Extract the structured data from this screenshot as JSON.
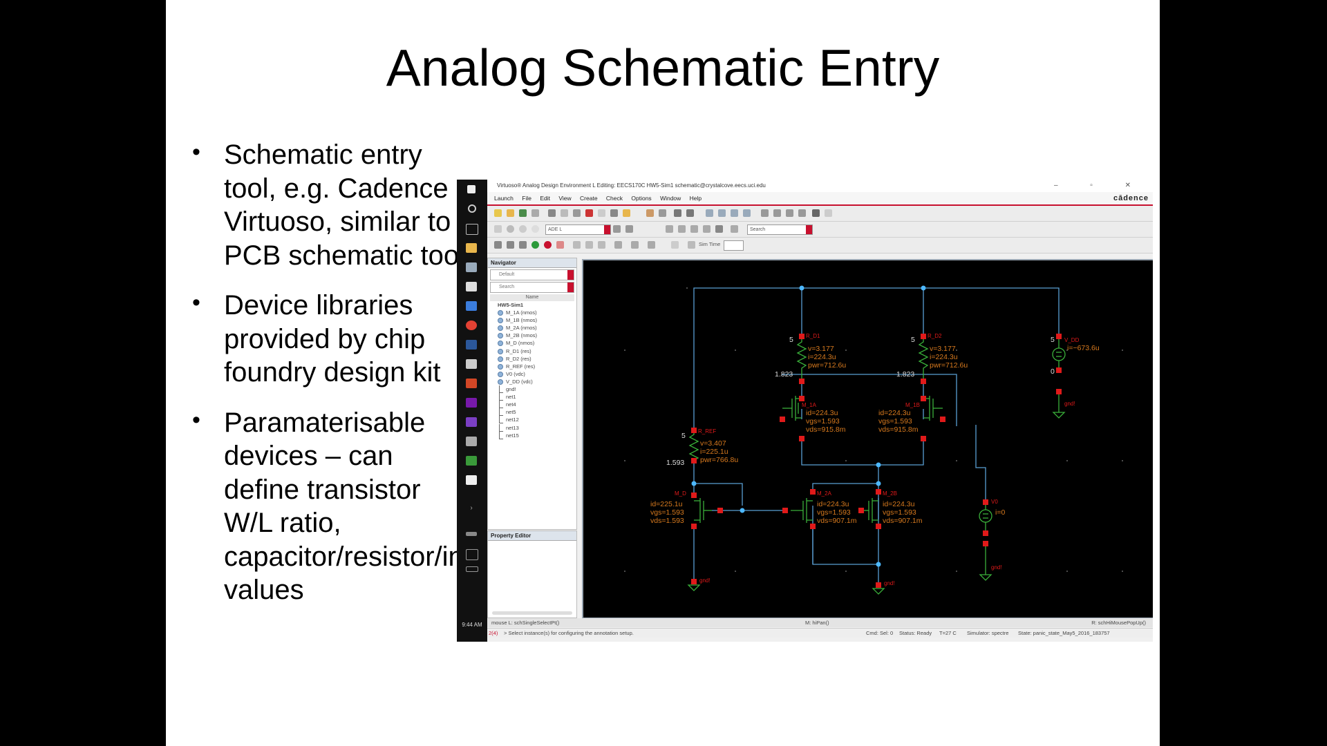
{
  "slide": {
    "title": "Analog Schematic Entry",
    "bullets": [
      "Schematic entry tool, e.g. Cadence Virtuoso, similar to PCB schematic tool",
      "Device libraries provided by chip foundry design kit",
      "Paramaterisable devices – can define transistor W/L ratio, capacitor/resistor/inductor values"
    ]
  },
  "taskbar": {
    "time": "9:44 AM"
  },
  "window": {
    "title": "Virtuoso® Analog Design Environment L Editing: EECS170C HW5-Sim1 schematic@crystalcove.eecs.uci.edu",
    "controls": "– ▫ ✕",
    "brand": "cādence",
    "menus": [
      "Launch",
      "File",
      "Edit",
      "View",
      "Create",
      "Check",
      "Options",
      "Window",
      "Help"
    ]
  },
  "toolbar": {
    "ade_combo": "ADE L",
    "search_placeholder": "Search",
    "sim_time_label": "Sim Time"
  },
  "navigator": {
    "title": "Navigator",
    "filter": "Default",
    "search_placeholder": "Search",
    "column": "Name",
    "root": "HW5-Sim1",
    "instances": [
      "M_1A (nmos)",
      "M_1B (nmos)",
      "M_2A (nmos)",
      "M_2B (nmos)",
      "M_D (nmos)",
      "R_D1 (res)",
      "R_D2 (res)",
      "R_REF (res)",
      "V0 (vdc)",
      "V_DD (vdc)"
    ],
    "nets": [
      "gnd!",
      "net1",
      "net4",
      "net5",
      "net12",
      "net13",
      "net15"
    ]
  },
  "property_editor": {
    "title": "Property Editor"
  },
  "schematic": {
    "rd1_label": "R_D1",
    "rd1_v": "v=3.177",
    "rd1_i": "i=224.3u",
    "rd1_p": "pwr=712.6u",
    "rd1_top": "5",
    "rd1_bot": "1.823",
    "rd2_label": "R_D2",
    "rd2_v": "v=3.177",
    "rd2_i": "i=224.3u",
    "rd2_p": "pwr=712.6u",
    "rd2_top": "5",
    "rd2_bot": "1.823",
    "vdd_label": "V_DD",
    "vdd_i": "i=−673.6u",
    "vdd_top": "5",
    "vdd_bot": "0",
    "vdd_gnd": "gnd!",
    "rref_label": "R_REF",
    "rref_v": "v=3.407",
    "rref_i": "i=225.1u",
    "rref_p": "pwr=766.8u",
    "rref_top": "5",
    "rref_bot": "1.593",
    "m1a_label": "M_1A",
    "m1a_id": "id=224.3u",
    "m1a_vgs": "vgs=1.593",
    "m1a_vds": "vds=915.8m",
    "m1b_label": "M_1B",
    "m1b_id": "id=224.3u",
    "m1b_vgs": "vgs=1.593",
    "m1b_vds": "vds=915.8m",
    "md_label": "M_D",
    "md_id": "id=225.1u",
    "md_vgs": "vgs=1.593",
    "md_vds": "vds=1.593",
    "m2a_label": "M_2A",
    "m2a_id": "id=224.3u",
    "m2a_vgs": "vgs=1.593",
    "m2a_vds": "vds=907.1m",
    "m2b_label": "M_2B",
    "m2b_id": "id=224.3u",
    "m2b_vgs": "vgs=1.593",
    "m2b_vds": "vds=907.1m",
    "v0_label": "V0",
    "v0_i": "i=0",
    "v0_gnd": "gnd!",
    "gnd1": "gnd!",
    "gnd2": "gnd!"
  },
  "status": {
    "mouse_l": "mouse L: schSingleSelectPt()",
    "mouse_m": "M: hiPan()",
    "mouse_r": "R: schHiMousePopUp()",
    "line_no": "2(4)",
    "message": "> Select instance(s) for configuring the annotation setup.",
    "cmd": "Cmd: Sel: 0",
    "state_ready": "Status: Ready",
    "temp": "T=27 C",
    "simulator": "Simulator: spectre",
    "state": "State: panic_state_May5_2016_183757"
  },
  "colors": {
    "wire": "#5a9fd4",
    "device": "#3ab03a",
    "pin": "#e01a1a",
    "annot": "#d87a1e",
    "node": "#4db8ff",
    "accent": "#c8102e"
  }
}
